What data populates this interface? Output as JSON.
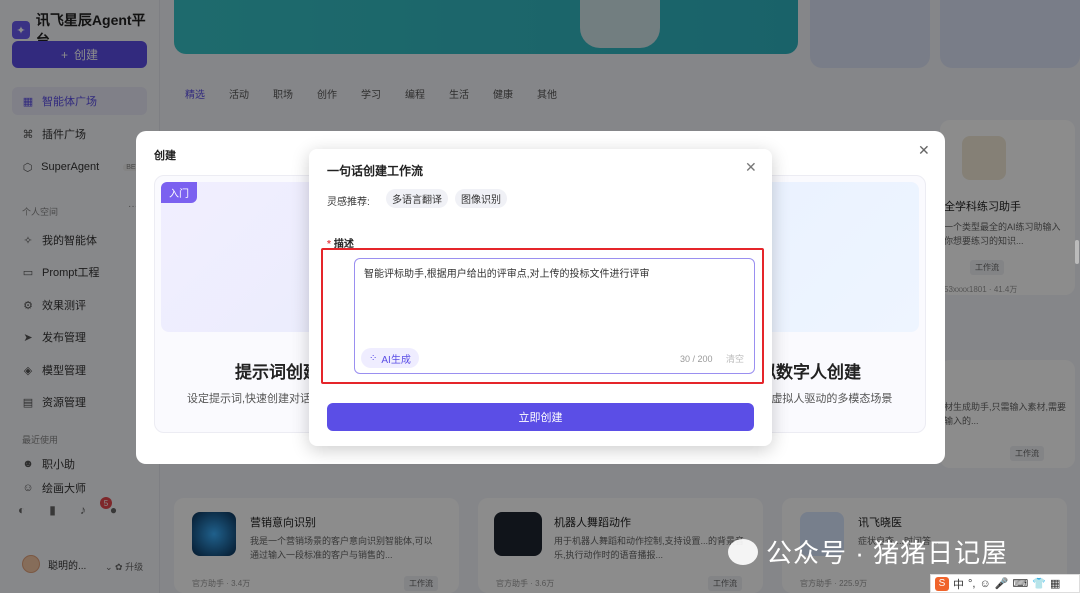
{
  "app": {
    "title": "讯飞星辰Agent平台",
    "create_label": "创建"
  },
  "sidebar": {
    "items": [
      {
        "label": "智能体广场",
        "icon": "grid-icon",
        "active": true
      },
      {
        "label": "插件广场",
        "icon": "puzzle-icon"
      },
      {
        "label": "SuperAgent",
        "icon": "agent-icon",
        "badge": "BETA"
      }
    ],
    "personal_section": "个人空间",
    "personal_items": [
      {
        "label": "我的智能体",
        "icon": "sparkle-icon"
      },
      {
        "label": "Prompt工程",
        "icon": "prompt-icon"
      },
      {
        "label": "效果测评",
        "icon": "test-icon"
      },
      {
        "label": "发布管理",
        "icon": "send-icon"
      },
      {
        "label": "模型管理",
        "icon": "model-icon"
      },
      {
        "label": "资源管理",
        "icon": "resource-icon"
      }
    ],
    "recent_section": "最近使用",
    "recent_items": [
      {
        "label": "职小助",
        "icon": "bot-icon"
      },
      {
        "label": "绘画大师",
        "icon": "paint-icon"
      }
    ],
    "notification_count": "5",
    "user": {
      "name": "聪明的...",
      "upgrade": "升级"
    }
  },
  "tabs": [
    "精选",
    "活动",
    "职场",
    "创作",
    "学习",
    "编程",
    "生活",
    "健康",
    "其他"
  ],
  "cards": [
    {
      "title": "营销意向识别",
      "desc": "我是一个营销场景的客户意向识别智能体,可以通过输入一段标准的客户与销售的...",
      "author": "官方助手",
      "count": "3.4万",
      "tag": "工作流"
    },
    {
      "title": "机器人舞蹈动作",
      "desc": "用于机器人舞蹈和动作控制,支持设置...的背景音乐,执行动作时的语音播报...",
      "author": "官方助手",
      "count": "3.6万",
      "tag": "工作流"
    },
    {
      "title": "讯飞晓医",
      "desc": "症状自查,...时问答...",
      "author": "官方助手",
      "count": "225.9万",
      "tag": ""
    },
    {
      "title": "全学科练习助手",
      "desc": "一个类型最全的AI练习助输入你想要练习的知识...",
      "author": "53xxxx1801",
      "count": "41.4万",
      "tag": "工作流"
    },
    {
      "title": "",
      "desc": "材生成助手,只需输入素材,需要输入的...",
      "author": "",
      "count": "",
      "tag": "工作流"
    }
  ],
  "create_modal": {
    "title": "创建",
    "options": [
      {
        "badge": "入门",
        "title": "提示词创建",
        "desc": "设定提示词,快速创建对话..."
      },
      {
        "badge": "",
        "title": "虚拟数字人创建",
        "desc": "交互&虚拟人驱动的多模态场景"
      }
    ]
  },
  "workflow_modal": {
    "title": "一句话创建工作流",
    "inspiration_label": "灵感推荐:",
    "chips": [
      "多语言翻译",
      "图像识别"
    ],
    "desc_label": "描述",
    "description_value": "智能评标助手,根据用户给出的评审点,对上传的投标文件进行评审",
    "ai_generate": "AI生成",
    "char_count": "30 / 200",
    "clear": "清空",
    "submit": "立即创建"
  },
  "watermark": "公众号 · 猪猪日记屋",
  "ime": {
    "labels": [
      "中",
      "°,",
      "☺",
      "🎤",
      "⌨",
      "👕",
      "▦"
    ]
  }
}
